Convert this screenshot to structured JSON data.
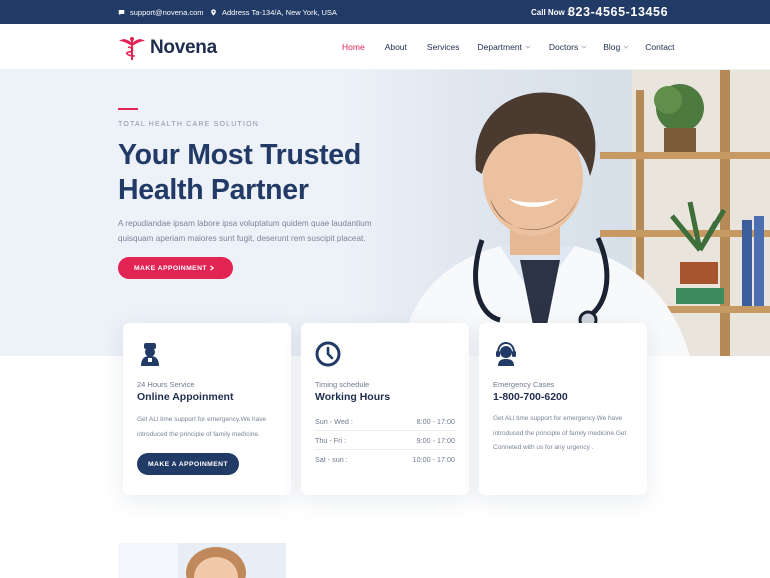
{
  "topbar": {
    "email": "support@novena.com",
    "address": "Address Ta-134/A, New York, USA",
    "call_label": "Call Now :",
    "phone": "823-4565-13456"
  },
  "nav": {
    "brand": "Novena",
    "items": [
      {
        "label": "Home",
        "active": true,
        "dropdown": false
      },
      {
        "label": "About",
        "active": false,
        "dropdown": false
      },
      {
        "label": "Services",
        "active": false,
        "dropdown": false
      },
      {
        "label": "Department",
        "active": false,
        "dropdown": true
      },
      {
        "label": "Doctors",
        "active": false,
        "dropdown": true
      },
      {
        "label": "Blog",
        "active": false,
        "dropdown": true
      },
      {
        "label": "Contact",
        "active": false,
        "dropdown": false
      }
    ]
  },
  "hero": {
    "kicker": "TOTAL HEALTH CARE SOLUTION",
    "title_line1": "Your Most Trusted",
    "title_line2": "Health Partner",
    "lead": "A repudiandae ipsam labore ipsa voluptatum quidem quae laudantium quisquam aperiam maiores sunt fugit, deserunt rem suscipit placeat.",
    "cta_label": "MAKE APPOINMENT",
    "cta_icon": "chevron-right-icon"
  },
  "cards": {
    "online": {
      "icon": "doctor-icon",
      "subtitle": "24 Hours Service",
      "title": "Online Appoinment",
      "text": "Get ALl time support for emergency.We have introduced the principle of family medicine.",
      "button": "MAKE A APPOINMENT"
    },
    "hours": {
      "icon": "clock-icon",
      "subtitle": "Timing schedule",
      "title": "Working Hours",
      "rows": [
        {
          "day": "Sun - Wed :",
          "time": "8:00 - 17:00"
        },
        {
          "day": "Thu - Fri :",
          "time": "9:00 - 17:00"
        },
        {
          "day": "Sat - sun :",
          "time": "10:00 - 17:00"
        }
      ]
    },
    "emergency": {
      "icon": "headset-icon",
      "subtitle": "Emergency Cases",
      "title": "1-800-700-6200",
      "text": "Get ALl time support for emergency.We have introduced the principle of family medicine.Get Conneted with us for any urgency ."
    }
  },
  "colors": {
    "navy": "#223a66",
    "accent": "#e12454",
    "hero_bg": "#edf1f8"
  }
}
